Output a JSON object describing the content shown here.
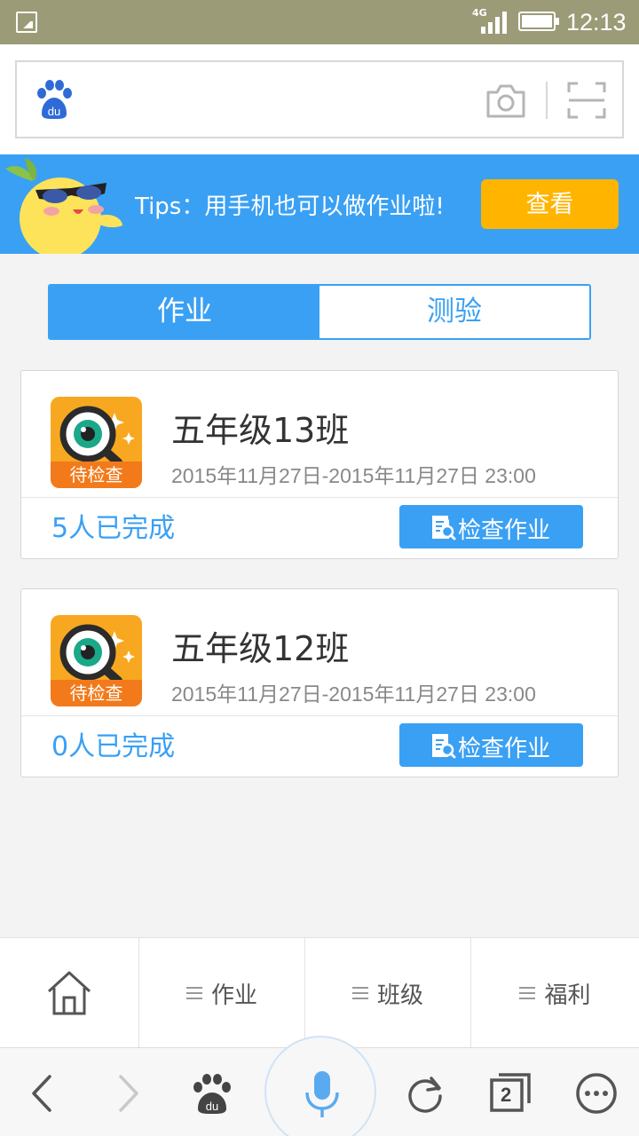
{
  "status_bar": {
    "network": "4G",
    "time": "12:13"
  },
  "search": {
    "logo_icon": "baidu-paw-icon",
    "camera_icon": "camera-icon",
    "scan_icon": "scan-icon"
  },
  "banner": {
    "tips": "Tips：用手机也可以做作业啦!",
    "view_button": "查看",
    "accent": "#3aa0f4",
    "button_color": "#ffb400"
  },
  "tabs": [
    {
      "label": "作业",
      "active": true
    },
    {
      "label": "测验",
      "active": false
    }
  ],
  "cards": [
    {
      "badge": "待检查",
      "title": "五年级13班",
      "dates": "2015年11月27日-2015年11月27日 23:00",
      "completed": "5人已完成",
      "button": "检查作业"
    },
    {
      "badge": "待检查",
      "title": "五年级12班",
      "dates": "2015年11月27日-2015年11月27日 23:00",
      "completed": "0人已完成",
      "button": "检查作业"
    }
  ],
  "menu": {
    "home_icon": "home-icon",
    "items": [
      "作业",
      "班级",
      "福利"
    ]
  },
  "toolbar": {
    "tab_count": "2"
  }
}
